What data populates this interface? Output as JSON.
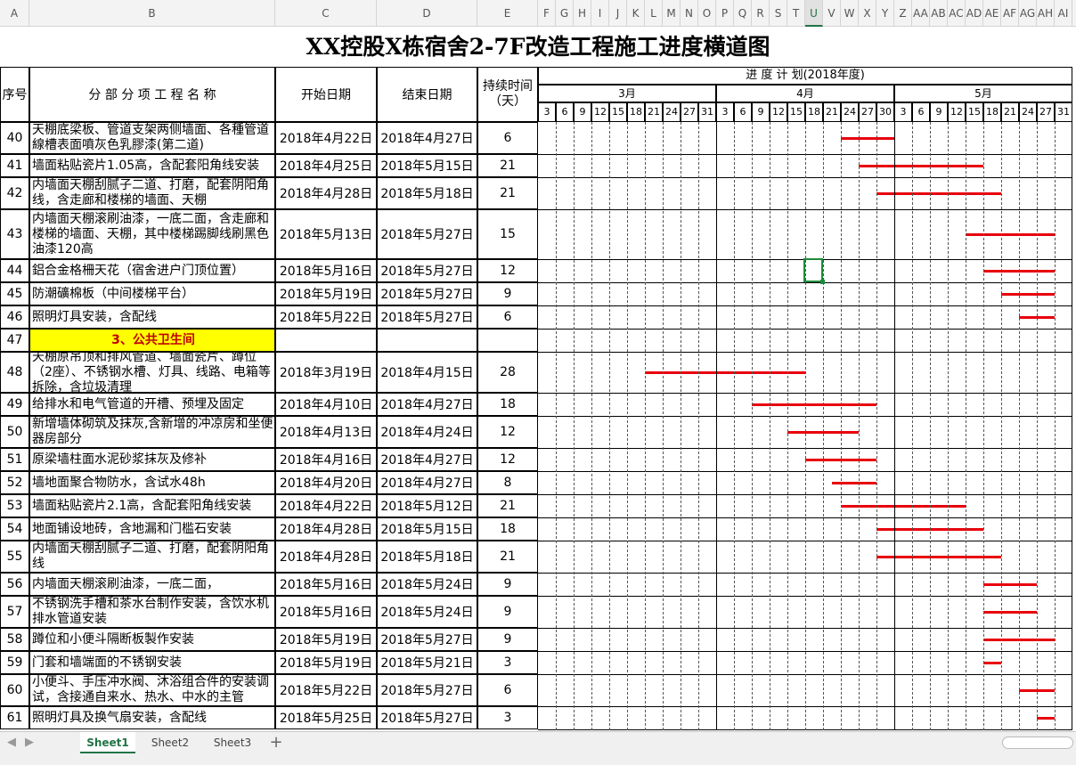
{
  "columns": [
    "A",
    "B",
    "C",
    "D",
    "E",
    "F",
    "G",
    "H",
    "I",
    "J",
    "K",
    "L",
    "M",
    "N",
    "O",
    "P",
    "Q",
    "R",
    "S",
    "T",
    "U",
    "V",
    "W",
    "X",
    "Y",
    "Z",
    "AA",
    "AB",
    "AC",
    "AD",
    "AE",
    "AF",
    "AG",
    "AH",
    "AI"
  ],
  "selected_column": "U",
  "title": "XX控股X栋宿舍2-7F改造工程施工进度横道图",
  "headers": {
    "seq": "序号",
    "name": "分 部 分 项 工 程 名 称",
    "start": "开始日期",
    "end": "结束日期",
    "duration": "持续时间（天）"
  },
  "schedule_title": "进 度 计 划(2018年度)",
  "months": [
    "3月",
    "4月",
    "5月"
  ],
  "month_days": [
    [
      "3",
      "6",
      "9",
      "12",
      "15",
      "18",
      "21",
      "24",
      "27",
      "31"
    ],
    [
      "3",
      "6",
      "9",
      "12",
      "15",
      "18",
      "21",
      "24",
      "27",
      "30"
    ],
    [
      "3",
      "6",
      "9",
      "12",
      "15",
      "18",
      "21",
      "24",
      "27",
      "31"
    ]
  ],
  "rows": [
    {
      "seq": "40",
      "name": "天棚底梁板、管道支架两侧墙面、各種管道線槽表面噴灰色乳膠漆(第二道)",
      "start": "2018年4月22日",
      "end": "2018年4月27日",
      "dur": "6",
      "bar": [
        34,
        40
      ]
    },
    {
      "seq": "41",
      "name": "墙面粘贴瓷片1.05高，含配套阳角线安装",
      "start": "2018年4月25日",
      "end": "2018年5月15日",
      "dur": "21",
      "bar": [
        36,
        50
      ]
    },
    {
      "seq": "42",
      "name": "内墙面天棚刮腻子二道、打磨，配套阴阳角线，含走廊和楼梯的墙面、天棚",
      "start": "2018年4月28日",
      "end": "2018年5月18日",
      "dur": "21",
      "bar": [
        38,
        52
      ]
    },
    {
      "seq": "43",
      "name": "内墙面天棚滚刷油漆，一底二面，含走廊和楼梯的墙面、天棚，其中楼梯踢脚线刷黑色油漆120高",
      "start": "2018年5月13日",
      "end": "2018年5月27日",
      "dur": "15",
      "bar": [
        48,
        58
      ]
    },
    {
      "seq": "44",
      "name": "鋁合金格柵天花（宿舍进户门顶位置）",
      "start": "2018年5月16日",
      "end": "2018年5月27日",
      "dur": "12",
      "bar": [
        50,
        58
      ]
    },
    {
      "seq": "45",
      "name": "防潮礦棉板（中间楼梯平台）",
      "start": "2018年5月19日",
      "end": "2018年5月27日",
      "dur": "9",
      "bar": [
        52,
        58
      ]
    },
    {
      "seq": "46",
      "name": "照明灯具安装，含配线",
      "start": "2018年5月22日",
      "end": "2018年5月27日",
      "dur": "6",
      "bar": [
        54,
        58
      ]
    },
    {
      "seq": "47",
      "name": "3、公共卫生间",
      "start": "",
      "end": "",
      "dur": "",
      "section": true
    },
    {
      "seq": "48",
      "name": "天棚原吊顶和排风管道、墙面瓷片、蹲位（2座）、不锈钢水槽、灯具、线路、电箱等拆除，含垃圾清理",
      "start": "2018年3月19日",
      "end": "2018年4月15日",
      "dur": "28",
      "bar": [
        12,
        30
      ]
    },
    {
      "seq": "49",
      "name": "给排水和电气管道的开槽、预埋及固定",
      "start": "2018年4月10日",
      "end": "2018年4月27日",
      "dur": "18",
      "bar": [
        24,
        38
      ]
    },
    {
      "seq": "50",
      "name": "新增墙体砌筑及抹灰,含新增的冲凉房和坐便器房部分",
      "start": "2018年4月13日",
      "end": "2018年4月24日",
      "dur": "12",
      "bar": [
        28,
        36
      ]
    },
    {
      "seq": "51",
      "name": "原梁墙柱面水泥砂浆抹灰及修补",
      "start": "2018年4月16日",
      "end": "2018年4月27日",
      "dur": "12",
      "bar": [
        30,
        38
      ]
    },
    {
      "seq": "52",
      "name": "墙地面聚合物防水，含试水48h",
      "start": "2018年4月20日",
      "end": "2018年4月27日",
      "dur": "8",
      "bar": [
        33,
        38
      ]
    },
    {
      "seq": "53",
      "name": "墙面粘贴瓷片2.1高，含配套阳角线安装",
      "start": "2018年4月22日",
      "end": "2018年5月12日",
      "dur": "21",
      "bar": [
        34,
        48
      ]
    },
    {
      "seq": "54",
      "name": "地面铺设地砖，含地漏和门槛石安装",
      "start": "2018年4月28日",
      "end": "2018年5月15日",
      "dur": "18",
      "bar": [
        38,
        50
      ]
    },
    {
      "seq": "55",
      "name": "内墙面天棚刮腻子二道、打磨，配套阴阳角线",
      "start": "2018年4月28日",
      "end": "2018年5月18日",
      "dur": "21",
      "bar": [
        38,
        52
      ]
    },
    {
      "seq": "56",
      "name": "内墙面天棚滚刷油漆，一底二面，",
      "start": "2018年5月16日",
      "end": "2018年5月24日",
      "dur": "9",
      "bar": [
        50,
        56
      ]
    },
    {
      "seq": "57",
      "name": "不锈钢洗手槽和茶水台制作安装，含饮水机排水管道安装",
      "start": "2018年5月16日",
      "end": "2018年5月24日",
      "dur": "9",
      "bar": [
        50,
        56
      ]
    },
    {
      "seq": "58",
      "name": "蹲位和小便斗隔断板製作安装",
      "start": "2018年5月19日",
      "end": "2018年5月27日",
      "dur": "9",
      "bar": [
        50,
        58
      ]
    },
    {
      "seq": "59",
      "name": "门套和墙端面的不锈钢安装",
      "start": "2018年5月19日",
      "end": "2018年5月21日",
      "dur": "3",
      "bar": [
        50,
        52
      ]
    },
    {
      "seq": "60",
      "name": "小便斗、手压冲水阀、沐浴组合件的安装调试，含接通自来水、热水、中水的主管",
      "start": "2018年5月22日",
      "end": "2018年5月27日",
      "dur": "6",
      "bar": [
        54,
        58
      ]
    },
    {
      "seq": "61",
      "name": "照明灯具及换气扇安装，含配线",
      "start": "2018年5月25日",
      "end": "2018年5月27日",
      "dur": "3",
      "bar": [
        56,
        58
      ]
    }
  ],
  "sheets": [
    "Sheet1",
    "Sheet2",
    "Sheet3"
  ],
  "active_sheet": "Sheet1",
  "add_sheet_label": "+",
  "nav_prev": "◀",
  "nav_next": "▶"
}
